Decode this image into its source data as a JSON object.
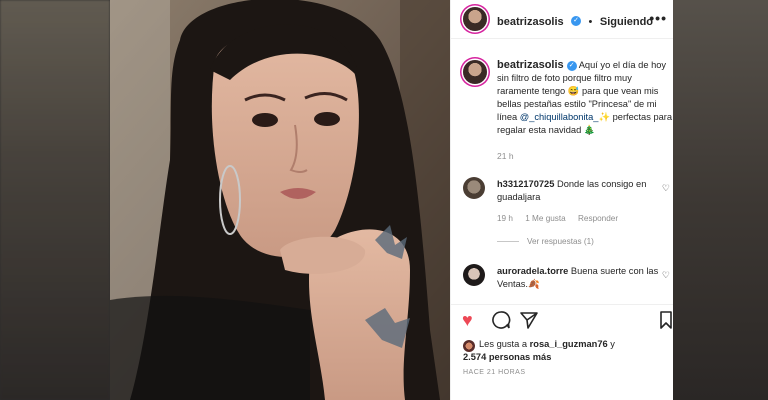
{
  "post": {
    "username": "beatrizasolis",
    "follow_status": "Siguiendo",
    "more_glyph": "•••",
    "separator": "•",
    "caption_text_1": "Aquí yo el día de hoy sin filtro de foto porque filtro muy raramente tengo ",
    "caption_emoji_1": "😅",
    "caption_text_2": " para que vean mis bellas pestañas estilo \"Princesa\" de mi línea ",
    "caption_mention": "@_chiquillabonita_",
    "caption_emoji_2": "✨",
    "caption_text_3": " perfectas para regalar esta navidad ",
    "caption_emoji_3": "🎄",
    "caption_time": "21 h"
  },
  "comments": [
    {
      "username": "h3312170725",
      "text": "Donde las consigo en guadaljara",
      "time": "19 h",
      "likes": "1 Me gusta",
      "reply": "Responder",
      "view_replies": "Ver respuestas (1)"
    },
    {
      "username": "auroradela.torre",
      "text": "Buena suerte con las Ventas.",
      "emoji": "🍂"
    }
  ],
  "likes": {
    "prefix": "Les gusta a ",
    "user": "rosa_i_guzman76",
    "middle": " y",
    "count": "2.574 personas más"
  },
  "timestamp": "HACE 21 HORAS",
  "colors": {
    "verified": "#3897f0",
    "heart": "#ed4956",
    "mention": "#00376b",
    "meta": "#8e8e8e"
  },
  "icons": [
    "verified-icon",
    "more-icon",
    "heart-icon",
    "comment-icon",
    "share-icon",
    "bookmark-icon"
  ]
}
